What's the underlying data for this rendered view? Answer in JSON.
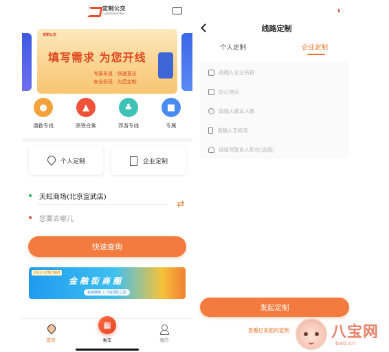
{
  "left_screen": {
    "logo": {
      "cn": "定制公交",
      "en": "Customized Bus"
    },
    "banner": {
      "logo_text": "定制公交",
      "title": "填写需求 为您开线",
      "line1": "专属车道 · 快速直达",
      "line2": "安全舒适 · 为您定制"
    },
    "quick_entries": [
      {
        "label": "通勤专线",
        "icon": "commute-icon",
        "color": "#f6a23a"
      },
      {
        "label": "高铁合乘",
        "icon": "train-icon",
        "color": "#f0533a"
      },
      {
        "label": "郊游专线",
        "icon": "palm-tree-icon",
        "color": "#3fc1b8"
      },
      {
        "label": "专属",
        "icon": "bus-icon",
        "color": "#4a8bf2"
      }
    ],
    "type_cards": {
      "personal": "个人定制",
      "enterprise": "企业定制"
    },
    "route": {
      "from": "天虹商场(北京宣武店)",
      "to_placeholder": "您要去哪儿"
    },
    "query_button": "快速查询",
    "ad": {
      "tag": "2023八大热门站点",
      "title": "金融街商圈",
      "subtitle": "金融精英 上下班轻松之选"
    },
    "tabbar": {
      "home": "首页",
      "ride": "乘车",
      "mine": "我的"
    }
  },
  "right_screen": {
    "title": "线路定制",
    "tabs": {
      "personal": "个人定制",
      "enterprise": "企业定制",
      "active": "enterprise"
    },
    "form": {
      "company_placeholder": "请输入企业名称",
      "office_placeholder": "办公地点",
      "passengers_placeholder": "请输入乘车人数",
      "phone_placeholder": "请输入手机号",
      "contact_placeholder": "请填写联系人职位(选填)"
    },
    "submit_button": "发起定制",
    "view_link": "查看已发起的定制"
  },
  "watermark": {
    "cn": "八宝网",
    "en": "bab.cn"
  },
  "colors": {
    "accent": "#f37b3f",
    "accent_text": "#f07228"
  }
}
